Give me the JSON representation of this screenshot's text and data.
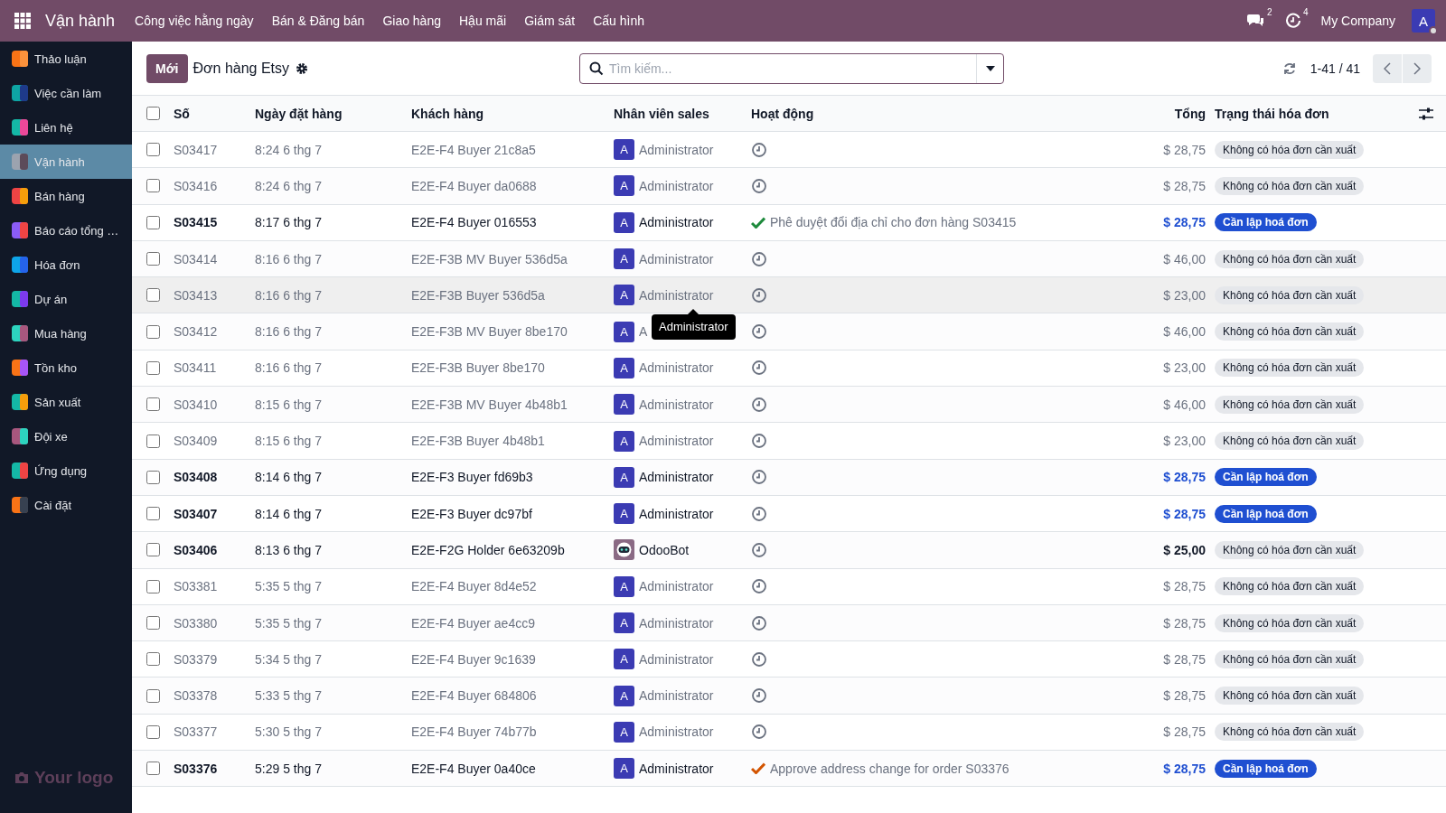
{
  "topbar": {
    "app_title": "Vận hành",
    "menu": [
      "Công việc hằng ngày",
      "Bán & Đăng bán",
      "Giao hàng",
      "Hậu mãi",
      "Giám sát",
      "Cấu hình"
    ],
    "messages_count": "2",
    "activities_count": "4",
    "company": "My Company",
    "avatar": "A"
  },
  "sidebar": {
    "items": [
      {
        "label": "Thảo luận",
        "selected": false
      },
      {
        "label": "Việc cần làm",
        "selected": false
      },
      {
        "label": "Liên hệ",
        "selected": false
      },
      {
        "label": "Vận hành",
        "selected": true
      },
      {
        "label": "Bán hàng",
        "selected": false
      },
      {
        "label": "Báo cáo tổng …",
        "selected": false
      },
      {
        "label": "Hóa đơn",
        "selected": false
      },
      {
        "label": "Dự án",
        "selected": false
      },
      {
        "label": "Mua hàng",
        "selected": false
      },
      {
        "label": "Tồn kho",
        "selected": false
      },
      {
        "label": "Sản xuất",
        "selected": false
      },
      {
        "label": "Đội xe",
        "selected": false
      },
      {
        "label": "Ứng dụng",
        "selected": false
      },
      {
        "label": "Cài đặt",
        "selected": false
      }
    ],
    "logo": "Your logo"
  },
  "control_panel": {
    "new_button": "Mới",
    "title": "Đơn hàng Etsy",
    "search": {
      "placeholder": "Tìm kiếm..."
    },
    "pager": "1-41 / 41"
  },
  "table": {
    "select_all": {
      "checked": false
    },
    "columns": [
      "Số",
      "Ngày đặt hàng",
      "Khách hàng",
      "Nhân viên sales",
      "Hoạt động",
      "Tổng",
      "Trạng thái hóa đơn"
    ],
    "rows": [
      {
        "number": "S03417",
        "date": "8:24 6 thg 7",
        "customer": "E2E-F4 Buyer 21c8a5",
        "salesperson": {
          "kind": "user",
          "avatar": "A",
          "name": "Administrator"
        },
        "activity": {
          "kind": "clock"
        },
        "total": "$ 28,75",
        "status": {
          "kind": "none",
          "label": "Không có hóa đơn cần xuất"
        },
        "bold": false,
        "hovered": false,
        "checked": false
      },
      {
        "number": "S03416",
        "date": "8:24 6 thg 7",
        "customer": "E2E-F4 Buyer da0688",
        "salesperson": {
          "kind": "user",
          "avatar": "A",
          "name": "Administrator"
        },
        "activity": {
          "kind": "clock"
        },
        "total": "$ 28,75",
        "status": {
          "kind": "none",
          "label": "Không có hóa đơn cần xuất"
        },
        "bold": false,
        "hovered": false,
        "checked": false
      },
      {
        "number": "S03415",
        "date": "8:17 6 thg 7",
        "customer": "E2E-F4 Buyer 016553",
        "salesperson": {
          "kind": "user",
          "avatar": "A",
          "name": "Administrator"
        },
        "activity": {
          "kind": "done",
          "text": "Phê duyệt đổi địa chỉ cho đơn hàng S03415",
          "color": "#1e8a3c"
        },
        "total": "$ 28,75",
        "status": {
          "kind": "to_invoice",
          "label": "Cần lập hoá đơn"
        },
        "bold": true,
        "hovered": false,
        "checked": false
      },
      {
        "number": "S03414",
        "date": "8:16 6 thg 7",
        "customer": "E2E-F3B MV Buyer 536d5a",
        "salesperson": {
          "kind": "user",
          "avatar": "A",
          "name": "Administrator"
        },
        "activity": {
          "kind": "clock"
        },
        "total": "$ 46,00",
        "status": {
          "kind": "none",
          "label": "Không có hóa đơn cần xuất"
        },
        "bold": false,
        "hovered": false,
        "checked": false
      },
      {
        "number": "S03413",
        "date": "8:16 6 thg 7",
        "customer": "E2E-F3B Buyer 536d5a",
        "salesperson": {
          "kind": "user",
          "avatar": "A",
          "name": "Administrator",
          "tooltip": "Administrator"
        },
        "activity": {
          "kind": "clock"
        },
        "total": "$ 23,00",
        "status": {
          "kind": "none",
          "label": "Không có hóa đơn cần xuất"
        },
        "bold": false,
        "hovered": true,
        "checked": false
      },
      {
        "number": "S03412",
        "date": "8:16 6 thg 7",
        "customer": "E2E-F3B MV Buyer 8be170",
        "salesperson": {
          "kind": "user",
          "avatar": "A",
          "name": "A"
        },
        "activity": {
          "kind": "clock"
        },
        "total": "$ 46,00",
        "status": {
          "kind": "none",
          "label": "Không có hóa đơn cần xuất"
        },
        "bold": false,
        "hovered": false,
        "checked": false
      },
      {
        "number": "S03411",
        "date": "8:16 6 thg 7",
        "customer": "E2E-F3B Buyer 8be170",
        "salesperson": {
          "kind": "user",
          "avatar": "A",
          "name": "Administrator"
        },
        "activity": {
          "kind": "clock"
        },
        "total": "$ 23,00",
        "status": {
          "kind": "none",
          "label": "Không có hóa đơn cần xuất"
        },
        "bold": false,
        "hovered": false,
        "checked": false
      },
      {
        "number": "S03410",
        "date": "8:15 6 thg 7",
        "customer": "E2E-F3B MV Buyer 4b48b1",
        "salesperson": {
          "kind": "user",
          "avatar": "A",
          "name": "Administrator"
        },
        "activity": {
          "kind": "clock"
        },
        "total": "$ 46,00",
        "status": {
          "kind": "none",
          "label": "Không có hóa đơn cần xuất"
        },
        "bold": false,
        "hovered": false,
        "checked": false
      },
      {
        "number": "S03409",
        "date": "8:15 6 thg 7",
        "customer": "E2E-F3B Buyer 4b48b1",
        "salesperson": {
          "kind": "user",
          "avatar": "A",
          "name": "Administrator"
        },
        "activity": {
          "kind": "clock"
        },
        "total": "$ 23,00",
        "status": {
          "kind": "none",
          "label": "Không có hóa đơn cần xuất"
        },
        "bold": false,
        "hovered": false,
        "checked": false
      },
      {
        "number": "S03408",
        "date": "8:14 6 thg 7",
        "customer": "E2E-F3 Buyer fd69b3",
        "salesperson": {
          "kind": "user",
          "avatar": "A",
          "name": "Administrator"
        },
        "activity": {
          "kind": "clock"
        },
        "total": "$ 28,75",
        "status": {
          "kind": "to_invoice",
          "label": "Cần lập hoá đơn"
        },
        "bold": true,
        "hovered": false,
        "checked": false
      },
      {
        "number": "S03407",
        "date": "8:14 6 thg 7",
        "customer": "E2E-F3 Buyer dc97bf",
        "salesperson": {
          "kind": "user",
          "avatar": "A",
          "name": "Administrator"
        },
        "activity": {
          "kind": "clock"
        },
        "total": "$ 28,75",
        "status": {
          "kind": "to_invoice",
          "label": "Cần lập hoá đơn"
        },
        "bold": true,
        "hovered": false,
        "checked": false
      },
      {
        "number": "S03406",
        "date": "8:13 6 thg 7",
        "customer": "E2E-F2G Holder 6e63209b",
        "salesperson": {
          "kind": "bot",
          "name": "OdooBot"
        },
        "activity": {
          "kind": "clock"
        },
        "total": "$ 25,00",
        "status": {
          "kind": "none",
          "label": "Không có hóa đơn cần xuất"
        },
        "bold": true,
        "hovered": false,
        "checked": false
      },
      {
        "number": "S03381",
        "date": "5:35 5 thg 7",
        "customer": "E2E-F4 Buyer 8d4e52",
        "salesperson": {
          "kind": "user",
          "avatar": "A",
          "name": "Administrator"
        },
        "activity": {
          "kind": "clock"
        },
        "total": "$ 28,75",
        "status": {
          "kind": "none",
          "label": "Không có hóa đơn cần xuất"
        },
        "bold": false,
        "hovered": false,
        "checked": false
      },
      {
        "number": "S03380",
        "date": "5:35 5 thg 7",
        "customer": "E2E-F4 Buyer ae4cc9",
        "salesperson": {
          "kind": "user",
          "avatar": "A",
          "name": "Administrator"
        },
        "activity": {
          "kind": "clock"
        },
        "total": "$ 28,75",
        "status": {
          "kind": "none",
          "label": "Không có hóa đơn cần xuất"
        },
        "bold": false,
        "hovered": false,
        "checked": false
      },
      {
        "number": "S03379",
        "date": "5:34 5 thg 7",
        "customer": "E2E-F4 Buyer 9c1639",
        "salesperson": {
          "kind": "user",
          "avatar": "A",
          "name": "Administrator"
        },
        "activity": {
          "kind": "clock"
        },
        "total": "$ 28,75",
        "status": {
          "kind": "none",
          "label": "Không có hóa đơn cần xuất"
        },
        "bold": false,
        "hovered": false,
        "checked": false
      },
      {
        "number": "S03378",
        "date": "5:33 5 thg 7",
        "customer": "E2E-F4 Buyer 684806",
        "salesperson": {
          "kind": "user",
          "avatar": "A",
          "name": "Administrator"
        },
        "activity": {
          "kind": "clock"
        },
        "total": "$ 28,75",
        "status": {
          "kind": "none",
          "label": "Không có hóa đơn cần xuất"
        },
        "bold": false,
        "hovered": false,
        "checked": false
      },
      {
        "number": "S03377",
        "date": "5:30 5 thg 7",
        "customer": "E2E-F4 Buyer 74b77b",
        "salesperson": {
          "kind": "user",
          "avatar": "A",
          "name": "Administrator"
        },
        "activity": {
          "kind": "clock"
        },
        "total": "$ 28,75",
        "status": {
          "kind": "none",
          "label": "Không có hóa đơn cần xuất"
        },
        "bold": false,
        "hovered": false,
        "checked": false
      },
      {
        "number": "S03376",
        "date": "5:29 5 thg 7",
        "customer": "E2E-F4 Buyer 0a40ce",
        "salesperson": {
          "kind": "user",
          "avatar": "A",
          "name": "Administrator"
        },
        "activity": {
          "kind": "done",
          "text": "Approve address change for order S03376",
          "color": "#d35400"
        },
        "total": "$ 28,75",
        "status": {
          "kind": "to_invoice",
          "label": "Cần lập hoá đơn"
        },
        "bold": true,
        "hovered": false,
        "checked": false
      }
    ]
  }
}
